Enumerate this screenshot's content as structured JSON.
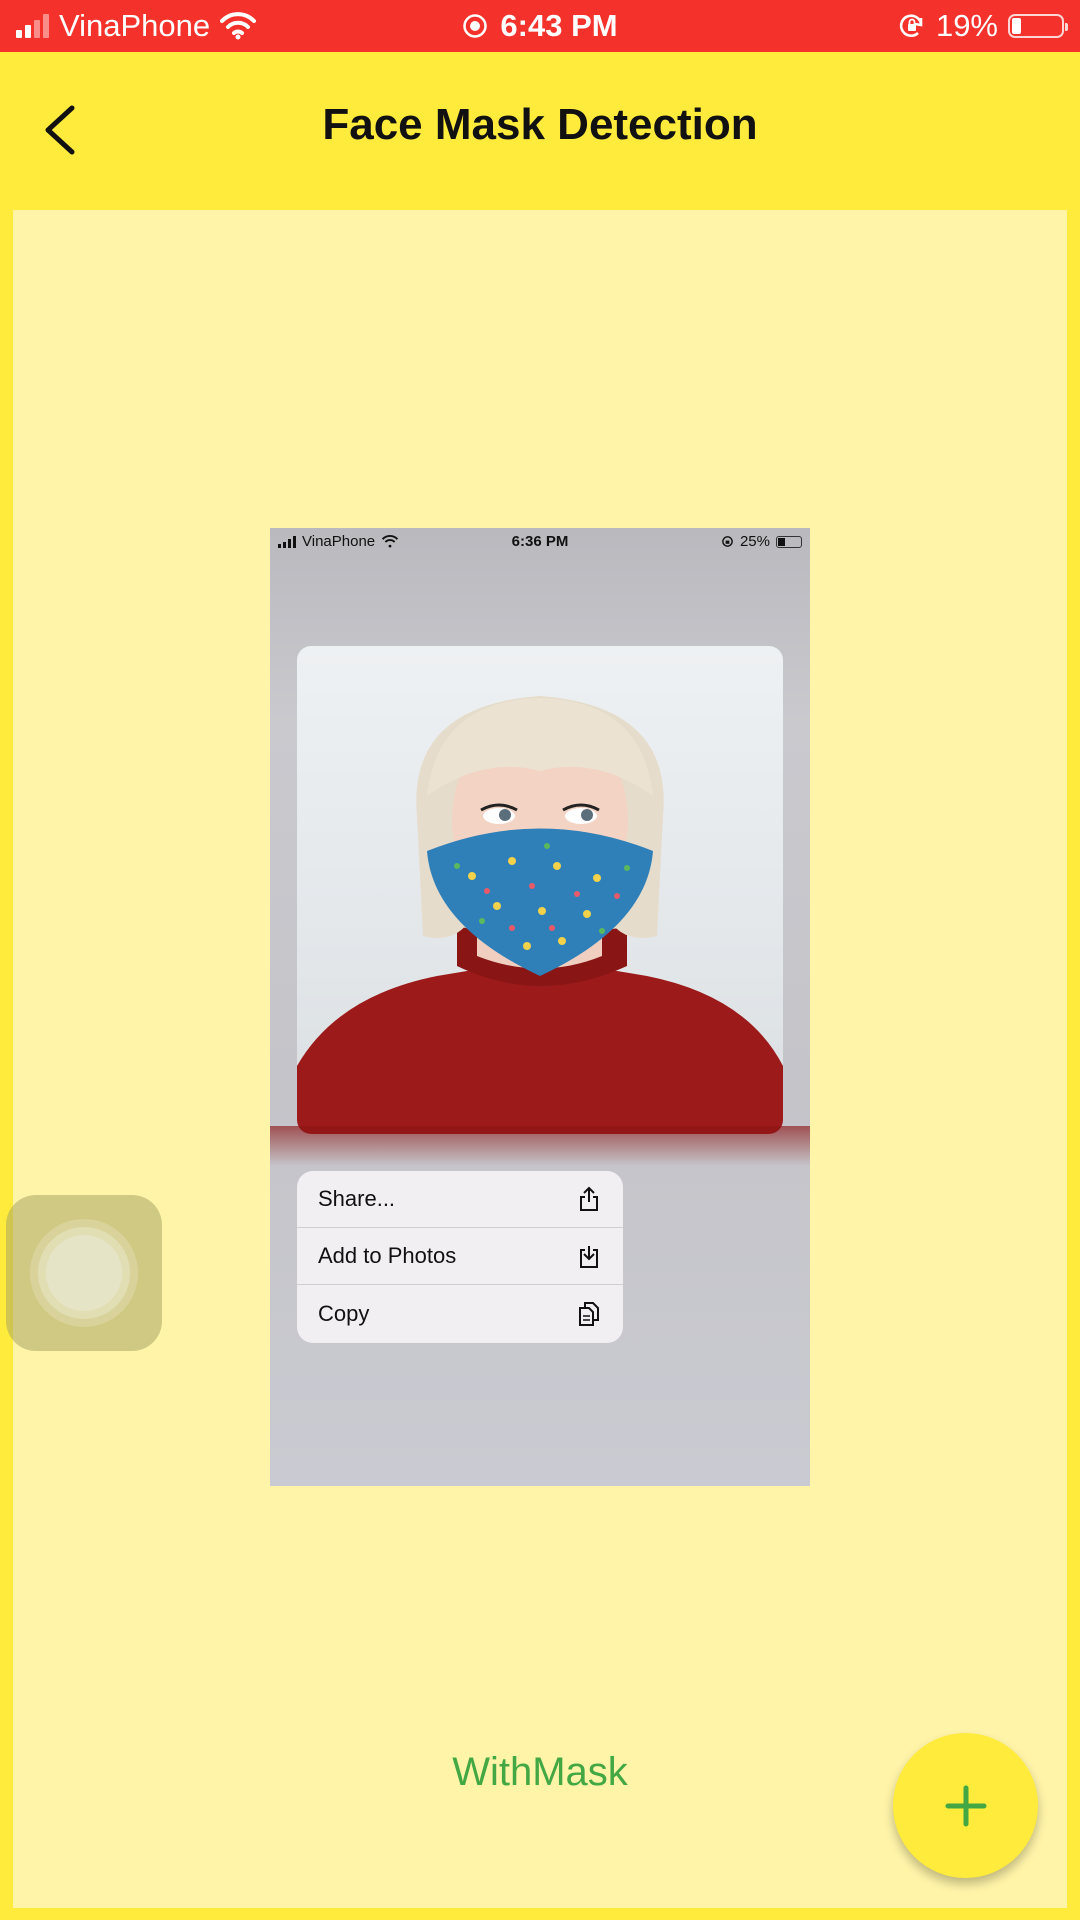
{
  "status_bar": {
    "carrier": "VinaPhone",
    "time": "6:43 PM",
    "battery": "19%"
  },
  "app_bar": {
    "title": "Face Mask Detection",
    "back_icon": "chevron-left-icon"
  },
  "screenshot": {
    "status_bar": {
      "carrier": "VinaPhone",
      "time": "6:36 PM",
      "battery": "25%"
    },
    "context_menu": [
      {
        "label": "Share...",
        "icon": "share-icon"
      },
      {
        "label": "Add to Photos",
        "icon": "save-to-photos-icon"
      },
      {
        "label": "Copy",
        "icon": "copy-icon"
      }
    ]
  },
  "result": {
    "label": "WithMask",
    "color": "#43a843"
  },
  "fab": {
    "icon": "plus-icon",
    "color": "#ffeb3b"
  },
  "colors": {
    "status_bar": "#f4312b",
    "app_bar": "#ffeb3b",
    "content_bg": "#fff4a8"
  }
}
